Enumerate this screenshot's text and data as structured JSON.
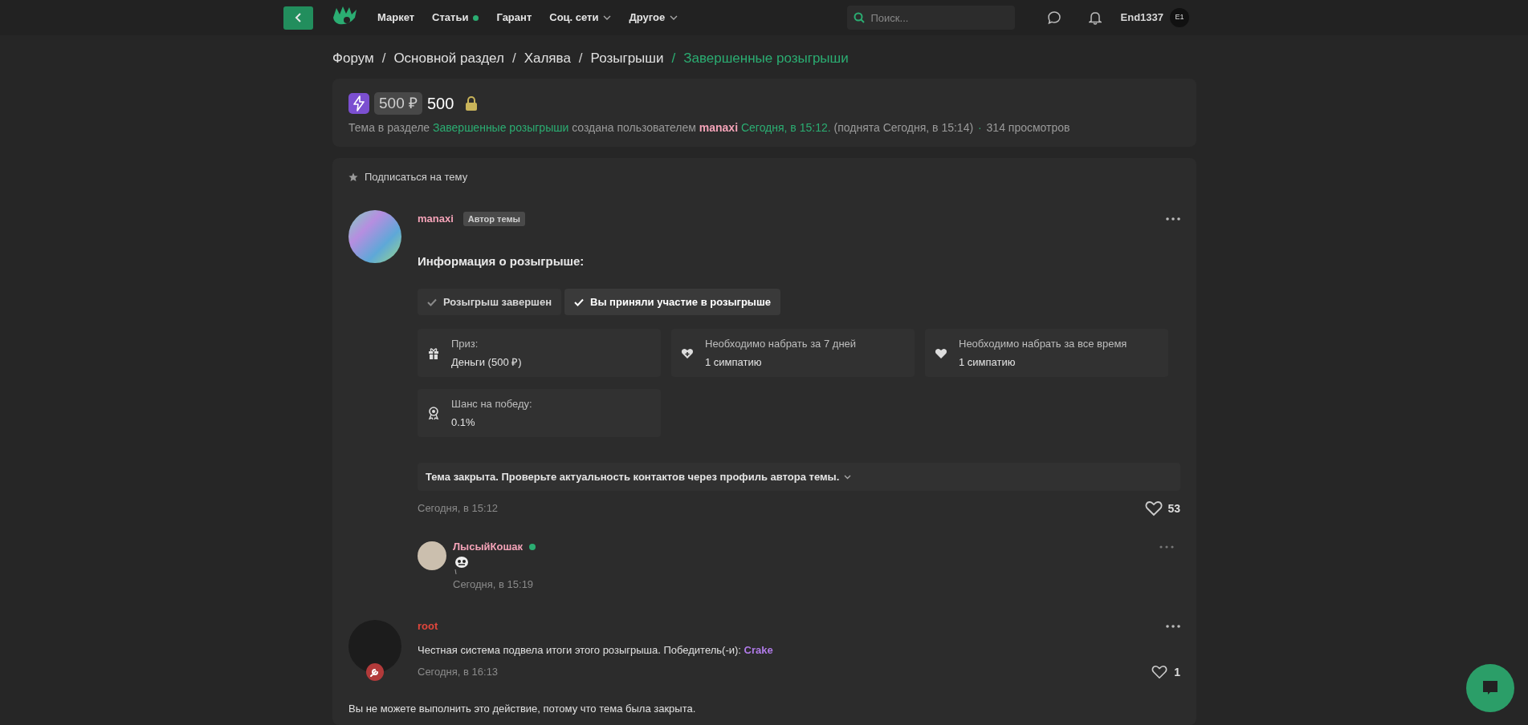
{
  "header": {
    "nav": [
      {
        "label": "Маркет",
        "dot": false,
        "dropdown": false
      },
      {
        "label": "Статьи",
        "dot": true,
        "dropdown": false
      },
      {
        "label": "Гарант",
        "dot": false,
        "dropdown": false
      },
      {
        "label": "Соц. сети",
        "dot": false,
        "dropdown": true
      },
      {
        "label": "Другое",
        "dot": false,
        "dropdown": true
      }
    ],
    "search": {
      "placeholder": "Поиск..."
    },
    "user": {
      "name": "End1337",
      "initials": "E1"
    }
  },
  "breadcrumb_separator": "/",
  "breadcrumbs": [
    {
      "label": "Форум",
      "current": false
    },
    {
      "label": "Основной раздел",
      "current": false
    },
    {
      "label": "Халява",
      "current": false
    },
    {
      "label": "Розыгрыши",
      "current": false
    },
    {
      "label": "Завершенные розыгрыши",
      "current": true
    }
  ],
  "thread": {
    "price": "500 ₽",
    "title": "500",
    "locked": true,
    "meta": [
      {
        "kind": "text",
        "text": "Тема в разделе"
      },
      {
        "kind": "link",
        "text": "Завершенные розыгрыши"
      },
      {
        "kind": "text",
        "text": "создана пользователем"
      },
      {
        "kind": "user",
        "text": "manaxi"
      },
      {
        "kind": "date",
        "text": "Сегодня, в 15:12."
      },
      {
        "kind": "text",
        "text": "(поднята Сегодня, в 15:14)"
      },
      {
        "kind": "bullet",
        "text": "·"
      },
      {
        "kind": "text",
        "text": "314 просмотров"
      }
    ]
  },
  "subscribe": "Подписаться на тему",
  "giveaway_post": {
    "author": {
      "name": "manaxi",
      "color": "#f4a3b8"
    },
    "badge": "Автор темы",
    "heading": "Информация о розыгрыше:",
    "statuses": [
      {
        "label": "Розыгрыш завершен",
        "active": false
      },
      {
        "label": "Вы приняли участие в розыгрыше",
        "active": true
      }
    ],
    "details": [
      {
        "kind": "gift",
        "label": "Приз:",
        "value": "Деньги (500 ₽)"
      },
      {
        "kind": "heart-plus",
        "label": "Необходимо набрать за 7 дней",
        "value": "1 симпатию"
      },
      {
        "kind": "heart",
        "label": "Необходимо набрать за все время",
        "value": "1 симпатию"
      },
      {
        "kind": "award",
        "label": "Шанс на победу:",
        "value": "0.1%"
      }
    ],
    "notice": "Тема закрыта. Проверьте актуальность контактов через профиль автора темы.",
    "date": "Сегодня, в 15:12",
    "likes": "53",
    "comment": {
      "author": {
        "name": "ЛысыйКошак",
        "color": "#f4a3b8"
      },
      "online": true,
      "date": "Сегодня, в 15:19"
    }
  },
  "result_post": {
    "author": {
      "name": "root",
      "color": "#e0463c"
    },
    "staff": true,
    "text": "Честная система подвела итоги этого розыгрыша. Победитель(-и):",
    "winner": "Crake",
    "date": "Сегодня, в 16:13",
    "likes": "1"
  },
  "closed_message": "Вы не можете выполнить это действие, потому что тема была закрыта."
}
